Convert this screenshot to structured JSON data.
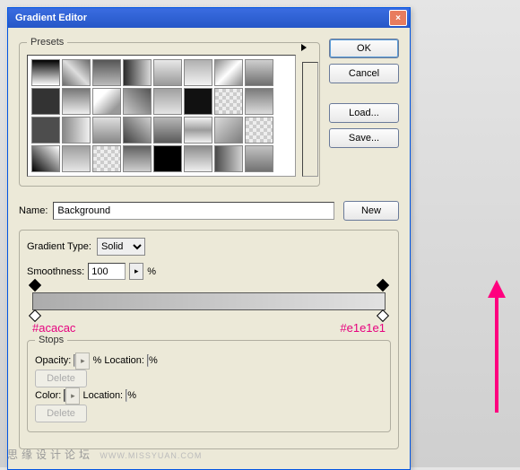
{
  "title": "Gradient Editor",
  "presets_label": "Presets",
  "buttons": {
    "ok": "OK",
    "cancel": "Cancel",
    "load": "Load...",
    "save": "Save...",
    "new": "New"
  },
  "name_label": "Name:",
  "name_value": "Background",
  "gradient_type_label": "Gradient Type:",
  "gradient_type_value": "Solid",
  "smoothness_label": "Smoothness:",
  "smoothness_value": "100",
  "percent": "%",
  "left_color": "#acacac",
  "right_color": "#e1e1e1",
  "stops_label": "Stops",
  "opacity_label": "Opacity:",
  "location_label": "Location:",
  "color_label": "Color:",
  "delete_label": "Delete",
  "watermark": "思缘设计论坛",
  "watermark_url": "WWW.MISSYUAN.COM",
  "swatches": [
    "linear-gradient(#000,#fff)",
    "linear-gradient(45deg,#6a6a6a,#ddd,#6a6a6a)",
    "linear-gradient(#555,#bbb)",
    "linear-gradient(90deg,#2b2b2b,#d9d9d9)",
    "linear-gradient(#e8e8e8,#999)",
    "linear-gradient(#b0b0b0,#f2f2f2)",
    "linear-gradient(135deg,#8a8a8a,#fff,#8a8a8a)",
    "linear-gradient(#cfcfcf,#6f6f6f)",
    "#333",
    "linear-gradient(#777,#eee)",
    "linear-gradient(135deg,#fff 30%,#999 80%)",
    "linear-gradient(45deg,#ccc,#555)",
    "linear-gradient(#a0a0a0,#e5e5e5)",
    "#111",
    "conic-gradient(#eee 25%,#ccc 0 50%,#eee 0 75%,#ccc 0)",
    "linear-gradient(#7a7a7a,#dcdcdc)",
    "#4d4d4d",
    "linear-gradient(90deg,#888,#f0f0f0)",
    "linear-gradient(#dedede,#888)",
    "linear-gradient(45deg,#404040,#cfcfcf)",
    "linear-gradient(#b7b7b7,#5a5a5a)",
    "linear-gradient(#f2f2f2,#9c9c9c,#f2f2f2)",
    "linear-gradient(135deg,#dadada,#7d7d7d)",
    "conic-gradient(#eee 25%,#ccc 0 50%,#eee 0 75%,#ccc 0)",
    "linear-gradient(45deg,#000,#fff)",
    "linear-gradient(#9e9e9e,#e6e6e6)",
    "conic-gradient(#eee 25%,#ccc 0 50%,#eee 0 75%,#ccc 0)",
    "linear-gradient(#606060,#cfcfcf)",
    "#000",
    "linear-gradient(#8c8c8c,#efefef)",
    "linear-gradient(90deg,#4a4a4a,#d1d1d1)",
    "linear-gradient(#c2c2c2,#727272)"
  ]
}
